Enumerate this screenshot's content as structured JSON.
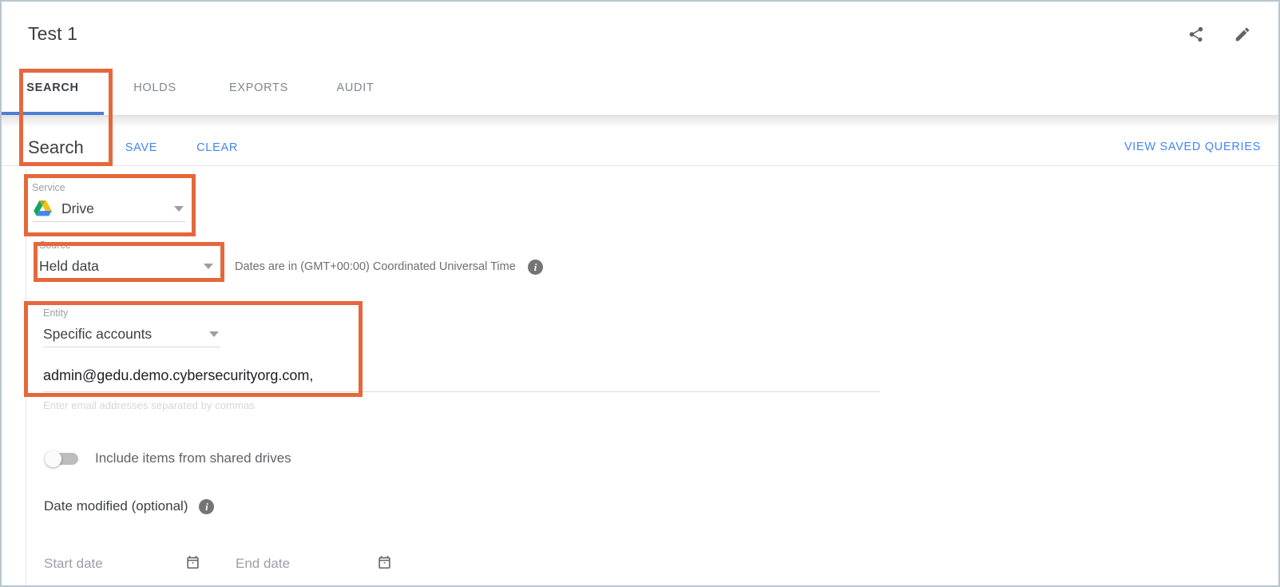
{
  "header": {
    "title": "Test 1",
    "share_icon": "share-icon",
    "edit_icon": "pencil-edit-icon"
  },
  "tabs": [
    {
      "label": "SEARCH",
      "active": true
    },
    {
      "label": "HOLDS",
      "active": false
    },
    {
      "label": "EXPORTS",
      "active": false
    },
    {
      "label": "AUDIT",
      "active": false
    }
  ],
  "search_bar": {
    "heading": "Search",
    "save_label": "SAVE",
    "clear_label": "CLEAR",
    "view_saved_queries_label": "VIEW SAVED QUERIES"
  },
  "form": {
    "service": {
      "label": "Service",
      "value": "Drive",
      "icon": "google-drive-icon"
    },
    "source": {
      "label": "Source",
      "value": "Held data"
    },
    "timezone_note": "Dates are in (GMT+00:00) Coordinated Universal Time",
    "timezone_info_icon": "info-icon",
    "entity": {
      "label": "Entity",
      "value": "Specific accounts"
    },
    "accounts": {
      "value": "admin@gedu.demo.cybersecurityorg.com,",
      "placeholder": "Enter email addresses separated by commas",
      "helper": "Enter email addresses separated by commas"
    },
    "shared_drives_toggle": {
      "label": "Include items from shared drives",
      "state": "off"
    },
    "date_modified": {
      "label": "Date modified (optional)",
      "info_icon": "info-icon"
    },
    "start_date": {
      "placeholder": "Start date",
      "icon": "calendar-icon"
    },
    "end_date": {
      "placeholder": "End date",
      "icon": "calendar-icon"
    }
  },
  "annotations": [
    {
      "name": "search-tab-and-heading-highlight"
    },
    {
      "name": "service-field-highlight"
    },
    {
      "name": "source-field-highlight"
    },
    {
      "name": "entity-and-accounts-highlight"
    }
  ],
  "colors": {
    "accent_blue": "#4285f4",
    "tab_underline": "#4a7fd4",
    "annotation_orange": "#e4683c",
    "text_primary": "#3c4043",
    "text_secondary": "#9aa0a6",
    "page_border": "#b9c6cf"
  }
}
